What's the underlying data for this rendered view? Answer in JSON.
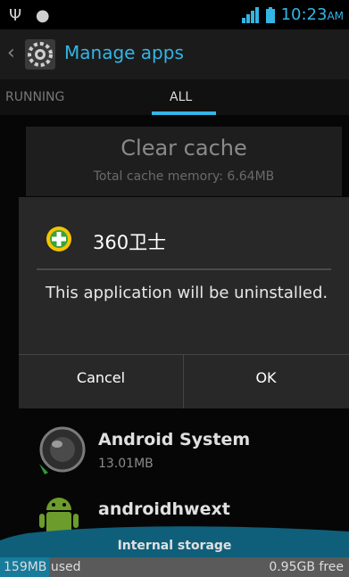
{
  "status_bar": {
    "time": "10:23",
    "ampm": "AM",
    "icons": [
      "usb-icon",
      "android-debug-icon",
      "signal-icon",
      "battery-charging-icon"
    ],
    "accent": "#33b5e5"
  },
  "action_bar": {
    "title": "Manage apps",
    "icon": "settings-gear-icon"
  },
  "tabs": [
    {
      "label": "RUNNING",
      "selected": false
    },
    {
      "label": "ALL",
      "selected": true
    }
  ],
  "clear_cache": {
    "title": "Clear cache",
    "subtitle": "Total cache memory: 6.64MB"
  },
  "dialog": {
    "app_name": "360卫士",
    "message": "This application will be uninstalled.",
    "cancel_label": "Cancel",
    "ok_label": "OK"
  },
  "apps": [
    {
      "name": "Android System",
      "size": "13.01MB",
      "icon": "android-system-icon"
    },
    {
      "name": "androidhwext",
      "icon": "android-robot-icon"
    }
  ],
  "storage": {
    "label": "Internal storage",
    "used": "159MB used",
    "free": "0.95GB free",
    "used_fraction": 0.14
  }
}
